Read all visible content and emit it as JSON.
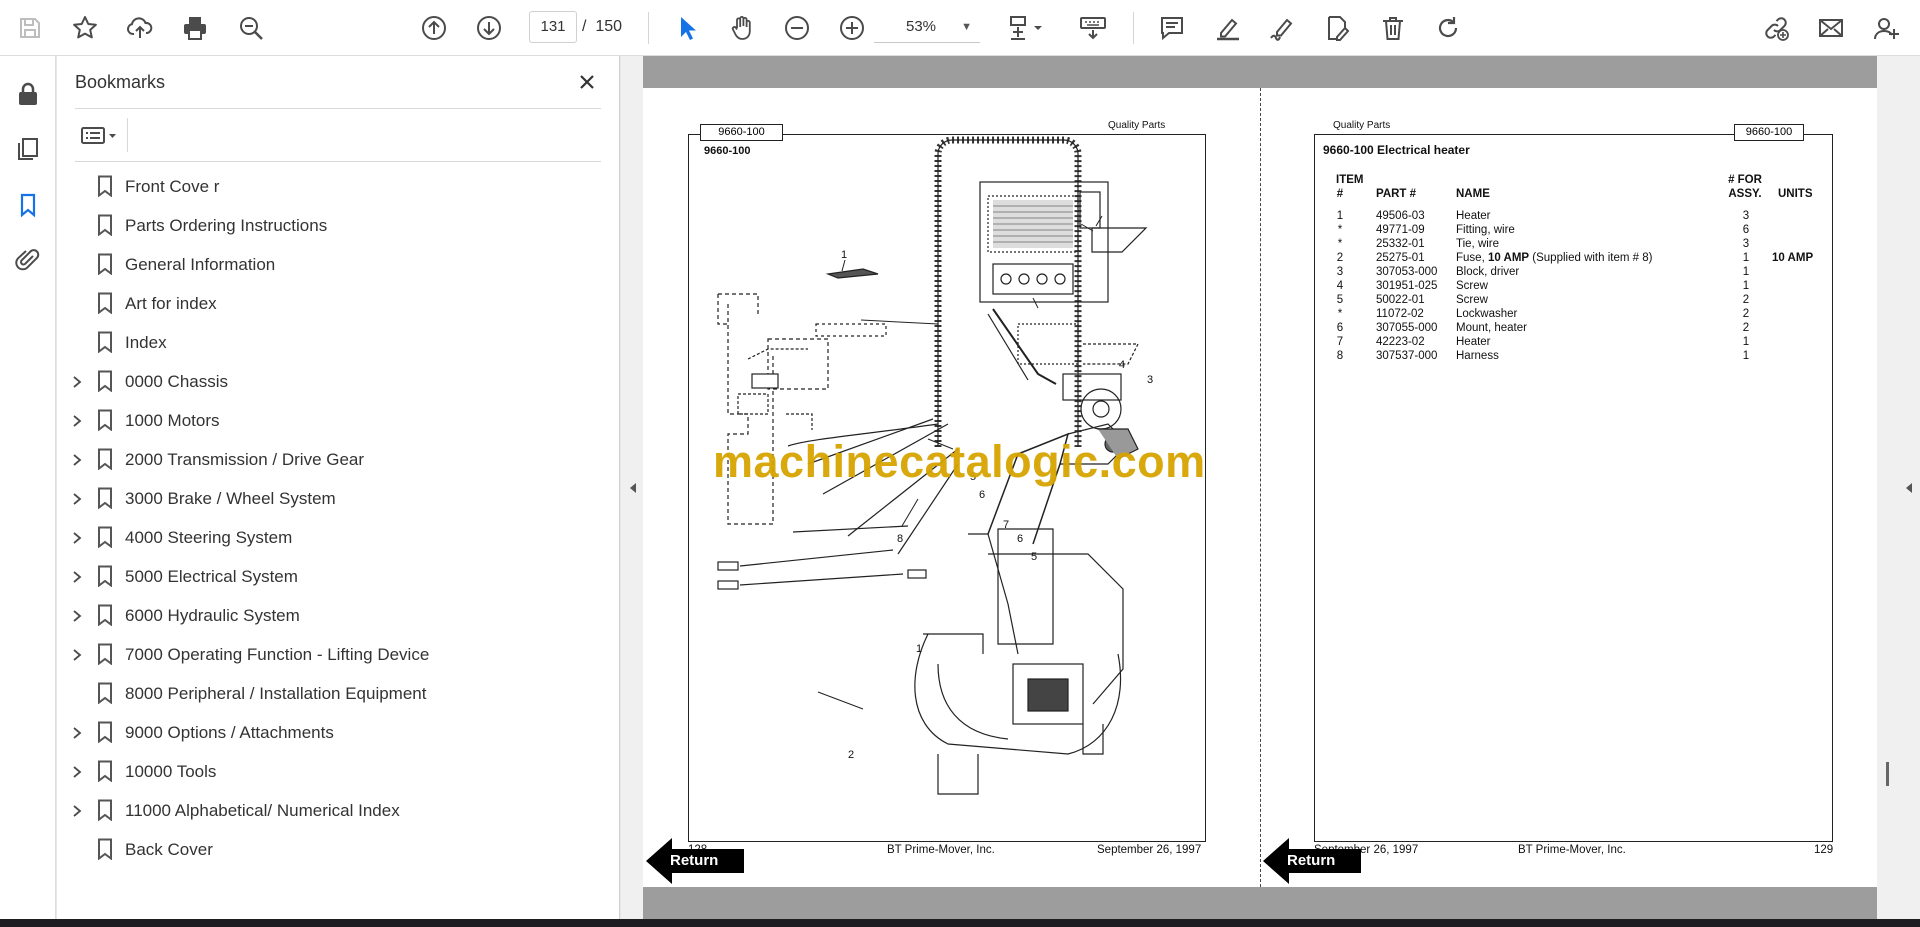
{
  "toolbar": {
    "current_page": "131",
    "page_separator": "/",
    "total_pages": "150",
    "zoom": "53%"
  },
  "bookmarks_panel": {
    "title": "Bookmarks",
    "items": [
      {
        "label": "Front Cove r",
        "expandable": false
      },
      {
        "label": "Parts Ordering Instructions",
        "expandable": false
      },
      {
        "label": "General Information",
        "expandable": false
      },
      {
        "label": "Art for index",
        "expandable": false
      },
      {
        "label": "Index",
        "expandable": false
      },
      {
        "label": "0000 Chassis",
        "expandable": true
      },
      {
        "label": "1000 Motors",
        "expandable": true
      },
      {
        "label": "2000 Transmission / Drive Gear",
        "expandable": true
      },
      {
        "label": "3000 Brake / Wheel System",
        "expandable": true
      },
      {
        "label": "4000 Steering System",
        "expandable": true
      },
      {
        "label": "5000 Electrical System",
        "expandable": true
      },
      {
        "label": "6000 Hydraulic System",
        "expandable": true
      },
      {
        "label": "7000 Operating Function - Lifting Device",
        "expandable": true
      },
      {
        "label": "8000 Peripheral / Installation Equipment",
        "expandable": false
      },
      {
        "label": "9000 Options / Attachments",
        "expandable": true
      },
      {
        "label": "10000 Tools",
        "expandable": true
      },
      {
        "label": "11000 Alphabetical/ Numerical Index",
        "expandable": true
      },
      {
        "label": "Back Cover",
        "expandable": false
      }
    ]
  },
  "left_page": {
    "tag": "9660-100",
    "header_right": "Quality Parts",
    "section_code": "9660-100",
    "footer_page": "128",
    "footer_company": "BT Prime-Mover, Inc.",
    "footer_date": "September 26, 1997",
    "return_label": "Return",
    "callouts": [
      "1",
      "2",
      "3",
      "4",
      "5",
      "6",
      "7",
      "8",
      "6",
      "5",
      "1"
    ]
  },
  "right_page": {
    "tag": "9660-100",
    "header_left": "Quality Parts",
    "title": "9660-100 Electrical heater",
    "headers": {
      "item_top": "ITEM",
      "item": "#",
      "part": "PART #",
      "name": "NAME",
      "qty_top": "# FOR",
      "qty": "ASSY.",
      "units": "UNITS"
    },
    "rows": [
      {
        "item": "1",
        "part": "49506-03",
        "name": "Heater",
        "name_extra": "",
        "qty": "3",
        "units": ""
      },
      {
        "item": "*",
        "part": "49771-09",
        "name": "Fitting, wire",
        "name_extra": "",
        "qty": "6",
        "units": ""
      },
      {
        "item": "*",
        "part": "25332-01",
        "name": "Tie, wire",
        "name_extra": "",
        "qty": "3",
        "units": ""
      },
      {
        "item": "2",
        "part": "25275-01",
        "name": "Fuse, ",
        "name_bold": "10 AMP",
        "name_extra": " (Supplied with item # 8)",
        "qty": "1",
        "units": "10 AMP"
      },
      {
        "item": "3",
        "part": "307053-000",
        "name": "Block, driver",
        "name_extra": "",
        "qty": "1",
        "units": ""
      },
      {
        "item": "4",
        "part": "301951-025",
        "name": "Screw",
        "name_extra": "",
        "qty": "1",
        "units": ""
      },
      {
        "item": "5",
        "part": "50022-01",
        "name": "Screw",
        "name_extra": "",
        "qty": "2",
        "units": ""
      },
      {
        "item": "*",
        "part": "11072-02",
        "name": "Lockwasher",
        "name_extra": "",
        "qty": "2",
        "units": ""
      },
      {
        "item": "6",
        "part": "307055-000",
        "name": "Mount, heater",
        "name_extra": "",
        "qty": "2",
        "units": ""
      },
      {
        "item": "7",
        "part": "42223-02",
        "name": "Heater",
        "name_extra": "",
        "qty": "1",
        "units": ""
      },
      {
        "item": "8",
        "part": "307537-000",
        "name": "Harness",
        "name_extra": "",
        "qty": "1",
        "units": ""
      }
    ],
    "footer_date": "September 26, 1997",
    "footer_company": "BT Prime-Mover, Inc.",
    "footer_page": "129",
    "return_label": "Return"
  },
  "watermark": "machinecatalogic.com",
  "colors": {
    "accent_blue": "#1473e6",
    "watermark": "#d6a400",
    "icon_gray": "#4b4b4b"
  },
  "icons": [
    "save-icon",
    "star-icon",
    "upload-icon",
    "print-icon",
    "zoom-search-icon",
    "arrow-up-icon",
    "arrow-down-icon",
    "select-cursor-icon",
    "hand-icon",
    "zoom-out-icon",
    "zoom-in-icon",
    "fit-page-icon",
    "keyboard-scroll-icon",
    "comment-icon",
    "highlight-icon",
    "sign-icon",
    "edit-pdf-icon",
    "delete-icon",
    "rotate-icon",
    "link-icon",
    "email-icon",
    "account-icon"
  ]
}
